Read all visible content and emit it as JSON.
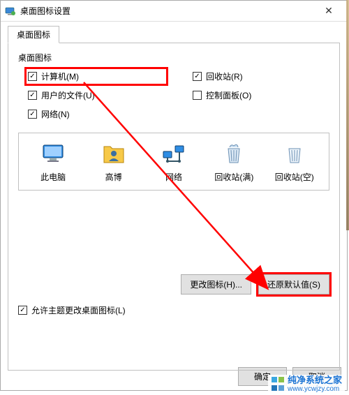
{
  "window": {
    "title": "桌面图标设置",
    "close_glyph": "✕"
  },
  "tab": {
    "label": "桌面图标"
  },
  "group": {
    "label": "桌面图标"
  },
  "checks": {
    "computer": {
      "label": "计算机(M)",
      "checked": true
    },
    "recycle": {
      "label": "回收站(R)",
      "checked": true
    },
    "userfiles": {
      "label": "用户的文件(U)",
      "checked": true
    },
    "ctrlpanel": {
      "label": "控制面板(O)",
      "checked": false
    },
    "network": {
      "label": "网络(N)",
      "checked": true
    }
  },
  "icons": {
    "thispc": "此电脑",
    "user": "高博",
    "network": "网络",
    "recycle_full": "回收站(满)",
    "recycle_empty": "回收站(空)"
  },
  "buttons": {
    "change_icon": "更改图标(H)...",
    "restore": "还原默认值(S)",
    "ok": "确定",
    "cancel": "取消"
  },
  "allow_themes": {
    "label": "允许主题更改桌面图标(L)",
    "checked": true
  },
  "watermark": {
    "name": "纯净系统之家",
    "url": "www.ycwjzy.com"
  }
}
